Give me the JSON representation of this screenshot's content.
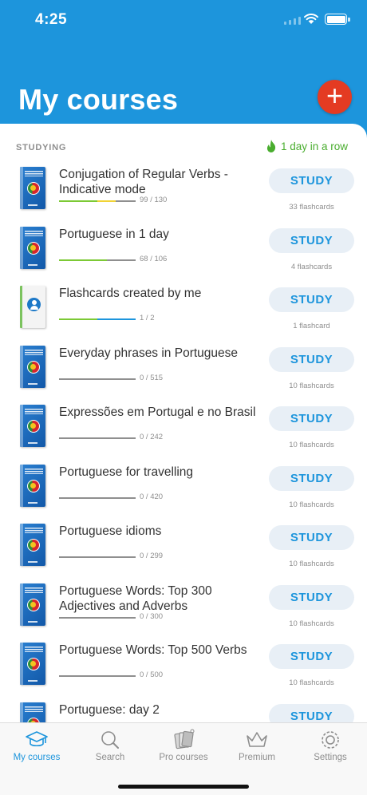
{
  "status_bar": {
    "time": "4:25"
  },
  "header": {
    "title": "My courses"
  },
  "section": {
    "label": "STUDYING",
    "streak": "1 day in a row"
  },
  "study_label": "STUDY",
  "courses": [
    {
      "title": "Conjugation of Regular Verbs - Indicative mode",
      "progress": "99 / 130",
      "cards": "33 flashcards",
      "green": 0.5,
      "second": 0.24,
      "second_color": "#f1d335",
      "cover": "blue"
    },
    {
      "title": "Portuguese in 1 day",
      "progress": "68 / 106",
      "cards": "4 flashcards",
      "green": 0.62,
      "second": 0,
      "second_color": "#1d95dc",
      "cover": "blue"
    },
    {
      "title": "Flashcards created by me",
      "progress": "1 / 2",
      "cards": "1 flashcard",
      "green": 0.5,
      "second": 0.5,
      "second_color": "#1d95dc",
      "cover": "white"
    },
    {
      "title": "Everyday phrases in Portuguese",
      "progress": "0 / 515",
      "cards": "10 flashcards",
      "green": 0,
      "second": 0,
      "second_color": "#1d95dc",
      "cover": "blue"
    },
    {
      "title": "Expressões em Portugal e no Brasil",
      "progress": "0 / 242",
      "cards": "10 flashcards",
      "green": 0,
      "second": 0,
      "second_color": "#1d95dc",
      "cover": "blue"
    },
    {
      "title": "Portuguese for travelling",
      "progress": "0 / 420",
      "cards": "10 flashcards",
      "green": 0,
      "second": 0,
      "second_color": "#1d95dc",
      "cover": "blue"
    },
    {
      "title": "Portuguese idioms",
      "progress": "0 / 299",
      "cards": "10 flashcards",
      "green": 0,
      "second": 0,
      "second_color": "#1d95dc",
      "cover": "blue"
    },
    {
      "title": "Portuguese Words: Top 300 Adjectives and Adverbs",
      "progress": "0 / 300",
      "cards": "10 flashcards",
      "green": 0,
      "second": 0,
      "second_color": "#1d95dc",
      "cover": "blue"
    },
    {
      "title": "Portuguese Words: Top 500 Verbs",
      "progress": "0 / 500",
      "cards": "10 flashcards",
      "green": 0,
      "second": 0,
      "second_color": "#1d95dc",
      "cover": "blue"
    },
    {
      "title": "Portuguese: day 2",
      "progress": "",
      "cards": "",
      "green": 0,
      "second": 0,
      "second_color": "#1d95dc",
      "cover": "blue"
    }
  ],
  "tabs": [
    {
      "label": "My courses",
      "icon": "graduation-cap-icon",
      "active": true
    },
    {
      "label": "Search",
      "icon": "magnifier-icon",
      "active": false
    },
    {
      "label": "Pro courses",
      "icon": "flashcard-stack-icon",
      "active": false
    },
    {
      "label": "Premium",
      "icon": "crown-icon",
      "active": false
    },
    {
      "label": "Settings",
      "icon": "gear-icon",
      "active": false
    }
  ],
  "colors": {
    "brand": "#1d95dc",
    "add": "#e43b22",
    "progress_green": "#7cc935",
    "streak": "#49ad2e"
  }
}
